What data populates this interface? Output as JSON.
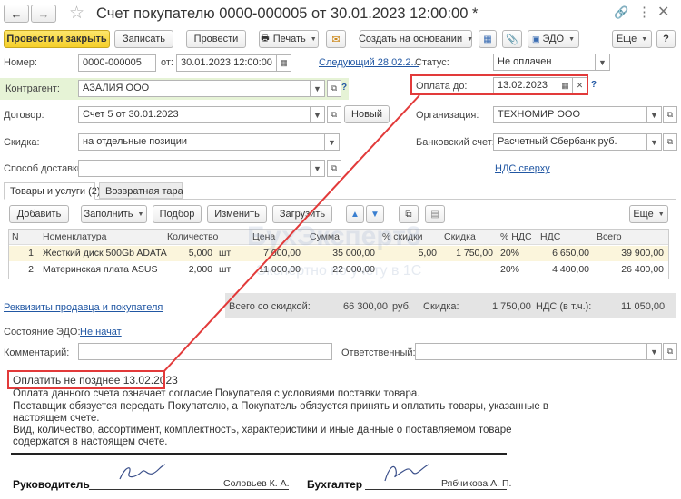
{
  "window": {
    "title": "Счет покупателю 0000-000005 от 30.01.2023 12:00:00 *"
  },
  "toolbar": {
    "post_close": "Провести и закрыть",
    "save": "Записать",
    "post": "Провести",
    "print": "Печать",
    "create_based": "Создать на основании",
    "edo": "ЭДО",
    "more": "Еще"
  },
  "form": {
    "number_label": "Номер:",
    "number_value": "0000-000005",
    "date_from_label": "от:",
    "date_value": "30.01.2023 12:00:00",
    "next_link": "Следующий 28.02.2...",
    "status_label": "Статус:",
    "status_value": "Не оплачен",
    "counterparty_label": "Контрагент:",
    "counterparty_value": "АЗАЛИЯ ООО",
    "pay_until_label": "Оплата до:",
    "pay_until_value": "13.02.2023",
    "contract_label": "Договор:",
    "contract_value": "Счет 5 от 30.01.2023",
    "new_button": "Новый",
    "org_label": "Организация:",
    "org_value": "ТЕХНОМИР ООО",
    "discount_label": "Скидка:",
    "discount_value": "на отдельные позиции",
    "bank_label": "Банковский счет:",
    "bank_value": "Расчетный Сбербанк руб.",
    "delivery_label": "Способ доставки:",
    "delivery_value": "",
    "vat_link": "НДС сверху",
    "help": "?"
  },
  "tabs": [
    "Товары и услуги (2)",
    "Возвратная тара"
  ],
  "table_toolbar": {
    "add": "Добавить",
    "fill": "Заполнить",
    "pick": "Подбор",
    "change": "Изменить",
    "load": "Загрузить",
    "more": "Еще"
  },
  "table": {
    "headers": [
      "N",
      "Номенклатура",
      "Количество",
      "Цена",
      "Сумма",
      "% скидки",
      "Скидка",
      "% НДС",
      "НДС",
      "Всего"
    ],
    "rows": [
      {
        "n": "1",
        "name": "Жесткий диск 500Gb ADATA",
        "qty": "5,000",
        "unit": "шт",
        "price": "7 000,00",
        "sum": "35 000,00",
        "disc_pct": "5,00",
        "disc": "1 750,00",
        "vat_pct": "20%",
        "vat": "6 650,00",
        "total": "39 900,00"
      },
      {
        "n": "2",
        "name": "Материнская плата ASUS",
        "qty": "2,000",
        "unit": "шт",
        "price": "11 000,00",
        "sum": "22 000,00",
        "disc_pct": "",
        "disc": "",
        "vat_pct": "20%",
        "vat": "4 400,00",
        "total": "26 400,00"
      }
    ]
  },
  "totals": {
    "requisites_link": "Реквизиты продавца и покупателя",
    "total_disc_label": "Всего со скидкой:",
    "total_disc_value": "66 300,00",
    "currency": "руб.",
    "disc_label": "Скидка:",
    "disc_value": "1 750,00",
    "vat_label": "НДС (в т.ч.):",
    "vat_value": "11 050,00"
  },
  "edo": {
    "state_label": "Состояние ЭДО:",
    "state_value": "Не начат",
    "comment_label": "Комментарий:",
    "responsible_label": "Ответственный:"
  },
  "document": {
    "pay_by": "Оплатить не позднее 13.02.2023",
    "line1": "Оплата данного счета означает согласие Покупателя с условиями поставки товара.",
    "line2": "Поставщик обязуется передать Покупателю, а Покупатель обязуется принять и оплатить товары, указанные в",
    "line3": "настоящем счете.",
    "line4": "Вид, количество, ассортимент, комплектность, характеристики и иные данные о поставляемом товаре",
    "line5": "содержатся в настоящем счете.",
    "head_label": "Руководитель",
    "head_name": "Соловьев К. А.",
    "acc_label": "Бухгалтер",
    "acc_name": "Рябчикова А. П."
  },
  "watermark": {
    "title": "БухЭксперт8",
    "subtitle": "Экспертно по учету в 1С"
  },
  "colors": {
    "accent_yellow": "#f5cf2a",
    "highlight_red": "#e23a3a",
    "link_blue": "#2157a3",
    "counterparty_green": "#e6f3d6"
  }
}
